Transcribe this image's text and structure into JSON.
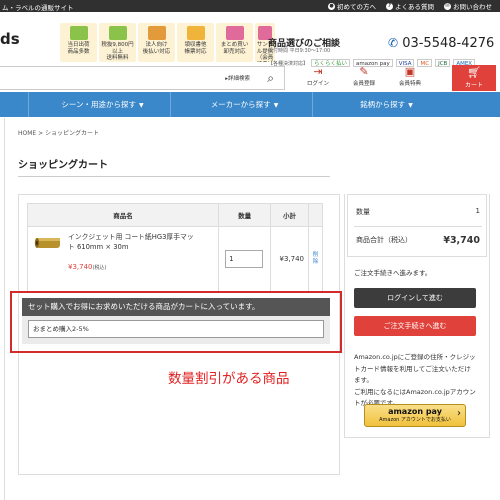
{
  "topbar": {
    "tagline": "ム・ラベルの通販サイト",
    "links": [
      {
        "label": "初めての方へ",
        "icon": "person-icon"
      },
      {
        "label": "よくある質問",
        "icon": "question-icon"
      },
      {
        "label": "お問い合わせ",
        "icon": "mail-icon"
      }
    ]
  },
  "header": {
    "logo_fragment": "ds",
    "features": [
      {
        "label": "当日出荷\n商品多数",
        "icon": "calendar-icon",
        "color": "#8ac24a"
      },
      {
        "label": "税抜9,800円以上\n送料無料",
        "icon": "truck-icon",
        "color": "#8ac24a"
      },
      {
        "label": "法人向け\n後払い対応",
        "icon": "building-icon",
        "color": "#e39a3b"
      },
      {
        "label": "領収書他\n帳票対応",
        "icon": "receipt-icon",
        "color": "#f0b43a"
      },
      {
        "label": "まとめ買い\n卸売対応",
        "icon": "cart-icon",
        "color": "#e06a9a"
      },
      {
        "label": "サンプル提供\n（会員特典）",
        "icon": "sample-icon",
        "color": "#e06a9a"
      }
    ],
    "consult_title": "商品選びのご相談",
    "hours": "受付時間 平日9:30～17:00",
    "phone": "03-5548-4276",
    "payments_label": "【各種決済対応】",
    "payments": [
      "らくらく払い",
      "amazon pay",
      "VISA",
      "MC",
      "JCB",
      "AMEX"
    ]
  },
  "search": {
    "detail_label": "▸詳細検索"
  },
  "header_icons": [
    {
      "label": "ログイン",
      "icon": "login-icon"
    },
    {
      "label": "会員登録",
      "icon": "register-icon"
    },
    {
      "label": "会員特典",
      "icon": "gift-icon"
    }
  ],
  "cart_button": {
    "label": "カート",
    "icon": "cart-icon"
  },
  "nav": {
    "items": [
      "シーン・用途から探す",
      "メーカーから探す",
      "銘柄から探す"
    ]
  },
  "breadcrumb": "HOME > ショッピングカート",
  "page_title": "ショッピングカート",
  "cart_table": {
    "headers": [
      "商品名",
      "数量",
      "小計"
    ],
    "rows": [
      {
        "name": "インクジェット用 コート紙HG3厚手マット 610mm × 30m",
        "price": "¥3,740",
        "price_note": "(税込)",
        "quantity": "1",
        "subtotal": "¥3,740",
        "delete_label": "削\n除"
      }
    ]
  },
  "set_notice": {
    "heading": "セット購入でお得にお求めいただける商品がカートに入っています。",
    "option": "おまとめ購入2-5%"
  },
  "annotation": "数量割引がある商品",
  "summary": {
    "quantity_label": "数量",
    "quantity_value": "1",
    "total_label": "商品合計（税込）",
    "total_value": "¥3,740",
    "proceed_note": "ご注文手続きへ進みます。",
    "login_button": "ログインして進む",
    "proceed_button": "ご注文手続きへ進む",
    "amazon_text": "Amazon.co.jpにご登録の住所・クレジットカード情報を利用してご注文いただけます。\nご利用になるにはAmazon.co.jpアカウントが必要です。",
    "amazon_button_main": "amazon pay",
    "amazon_button_sub": "Amazon アカウントでお支払い"
  },
  "colors": {
    "brand_blue": "#3a87c9",
    "accent_red": "#e0413b",
    "annotation_red": "#d42a2a"
  }
}
